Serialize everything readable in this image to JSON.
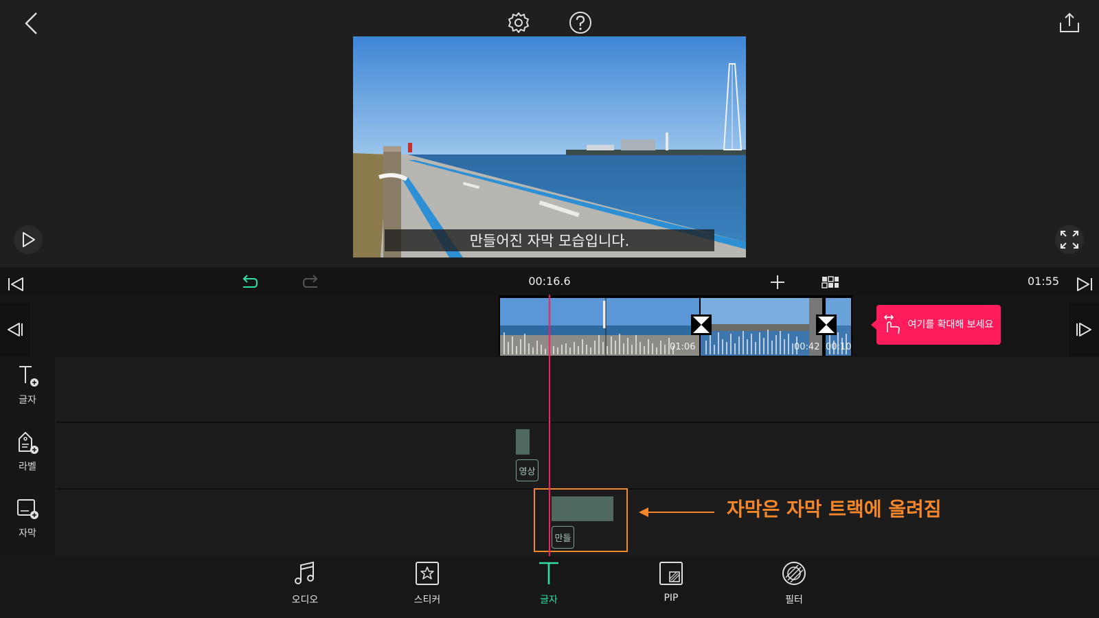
{
  "preview": {
    "subtitle": "만들어진 자막 모습입니다."
  },
  "timeline": {
    "current_time": "00:16.6",
    "total_time": "01:55",
    "clips": [
      {
        "duration": "01:06"
      },
      {
        "duration": "00:42"
      },
      {
        "duration": "00:10"
      }
    ],
    "tip": "여기를 확대해 보세요"
  },
  "track_tools": [
    {
      "label": "글자",
      "icon": "text-add-icon"
    },
    {
      "label": "라벨",
      "icon": "label-add-icon"
    },
    {
      "label": "자막",
      "icon": "subtitle-add-icon"
    }
  ],
  "tracks": {
    "label_clip_tag": "영상",
    "subtitle_clip_tag": "만들"
  },
  "annotation": {
    "text": "자막은 자막 트랙에 올려짐",
    "color": "#f5862a"
  },
  "bottom_tools": [
    {
      "label": "오디오",
      "icon": "music-note-icon"
    },
    {
      "label": "스티커",
      "icon": "sticker-icon"
    },
    {
      "label": "글자",
      "icon": "text-icon",
      "active": true
    },
    {
      "label": "PIP",
      "icon": "pip-icon"
    },
    {
      "label": "필터",
      "icon": "filter-icon"
    }
  ],
  "colors": {
    "accent": "#2fe0a0",
    "playhead": "#ff1c5c",
    "tip_bg": "#ff1c5c",
    "highlight": "#f08a2a"
  }
}
